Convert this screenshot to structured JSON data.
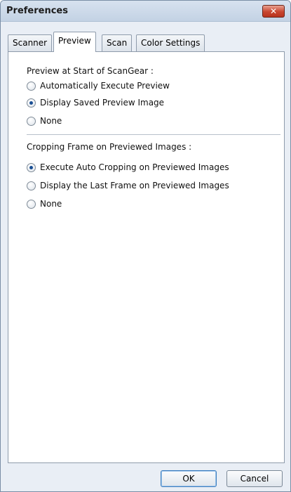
{
  "window": {
    "title": "Preferences"
  },
  "tabs": [
    {
      "label": "Scanner",
      "active": false
    },
    {
      "label": "Preview",
      "active": true
    },
    {
      "label": "Scan",
      "active": false
    },
    {
      "label": "Color Settings",
      "active": false
    }
  ],
  "preview_start": {
    "heading": "Preview at Start of ScanGear :",
    "options": [
      {
        "label": "Automatically Execute Preview",
        "selected": false
      },
      {
        "label": "Display Saved Preview Image",
        "selected": true
      },
      {
        "label": "None",
        "selected": false
      }
    ]
  },
  "cropping": {
    "heading": "Cropping Frame on Previewed Images :",
    "options": [
      {
        "label": "Execute Auto Cropping on Previewed Images",
        "selected": true
      },
      {
        "label": "Display the Last Frame on Previewed Images",
        "selected": false
      },
      {
        "label": "None",
        "selected": false
      }
    ]
  },
  "buttons": {
    "ok": "OK",
    "cancel": "Cancel"
  }
}
